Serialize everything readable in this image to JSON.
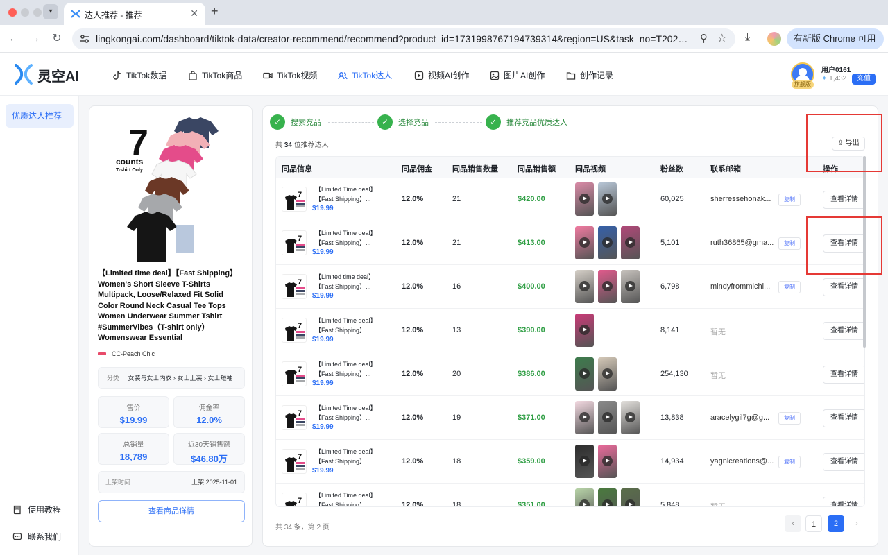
{
  "browser": {
    "tab_title": "达人推荐 - 推荐",
    "tab_close": "✕",
    "new_tab": "+",
    "url": "lingkongai.com/dashboard/tiktok-data/creator-recommend/recommend?product_id=1731998767194739314&region=US&task_no=T20260630193...",
    "update_label": "有新版 Chrome 可用"
  },
  "app": {
    "logo_text": "灵空AI",
    "nav": [
      {
        "label": "TikTok数据",
        "icon": "tiktok-icon"
      },
      {
        "label": "TikTok商品",
        "icon": "shopping-bag-icon"
      },
      {
        "label": "TikTok视频",
        "icon": "video-camera-icon"
      },
      {
        "label": "TikTok达人",
        "icon": "users-icon",
        "active": true
      },
      {
        "label": "视频AI创作",
        "icon": "ai-video-icon"
      },
      {
        "label": "图片AI创作",
        "icon": "image-icon"
      },
      {
        "label": "创作记录",
        "icon": "folder-icon"
      }
    ],
    "user": {
      "name": "用户0161",
      "vip": "旗舰版",
      "points": "1,432",
      "recharge": "充值"
    }
  },
  "sidebar": {
    "active_item": "优质达人推荐",
    "footer": [
      {
        "label": "使用教程",
        "icon": "book-icon"
      },
      {
        "label": "联系我们",
        "icon": "chat-icon"
      }
    ]
  },
  "product": {
    "image_count": "7",
    "image_counts_word": "counts",
    "image_sub": "T-shirt Only",
    "title": "【Limited time deal】【Fast Shipping】Women's Short Sleeve T-Shirts Multipack, Loose/Relaxed Fit Solid Color Round Neck Casual Tee Tops Women Underwear Summer Tshirt #SummerVibes（T-shirt only）Womenswear Essential",
    "shop": "CC-Peach Chic",
    "category_label": "分类",
    "category": "女装与女士内衣 › 女士上装 › 女士短袖",
    "stats": [
      {
        "label": "售价",
        "value": "$19.99"
      },
      {
        "label": "佣金率",
        "value": "12.0%"
      },
      {
        "label": "总销量",
        "value": "18,789"
      },
      {
        "label": "近30天销售额",
        "value": "$46.80万"
      }
    ],
    "listing_label": "上架时间",
    "listing_value": "上架 2025-11-01",
    "view_button": "查看商品详情"
  },
  "steps": [
    "搜索竞品",
    "选择竞品",
    "推荐竞品优质达人"
  ],
  "summary": {
    "prefix": "共",
    "count": "34",
    "suffix": "位推荐达人"
  },
  "export_label": "导出",
  "table": {
    "headers": [
      "同品信息",
      "同品佣金",
      "同品销售数量",
      "同品销售额",
      "同品视频",
      "粉丝数",
      "联系邮箱",
      "操作"
    ],
    "copy_label": "复制",
    "detail_label": "查看详情",
    "rows": [
      {
        "line1": "【Limited Time deal】",
        "line2": "【Fast Shipping】...",
        "price": "$19.99",
        "commission": "12.0%",
        "qty": "21",
        "amount": "$420.00",
        "videos": 2,
        "fans": "60,025",
        "email": "sherressehonak...",
        "has_email": true
      },
      {
        "line1": "【Limited Time deal】",
        "line2": "【Fast Shipping】...",
        "price": "$19.99",
        "commission": "12.0%",
        "qty": "21",
        "amount": "$413.00",
        "videos": 3,
        "fans": "5,101",
        "email": "ruth36865@gma...",
        "has_email": true
      },
      {
        "line1": "【Limited time deal】",
        "line2": "【Fast Shipping】...",
        "price": "$19.99",
        "commission": "12.0%",
        "qty": "16",
        "amount": "$400.00",
        "videos": 3,
        "fans": "6,798",
        "email": "mindyfrommichi...",
        "has_email": true
      },
      {
        "line1": "【Limited Time deal】",
        "line2": "【Fast Shipping】...",
        "price": "$19.99",
        "commission": "12.0%",
        "qty": "13",
        "amount": "$390.00",
        "videos": 1,
        "fans": "8,141",
        "email": "暂无",
        "has_email": false
      },
      {
        "line1": "【Limited Time deal】",
        "line2": "【Fast Shipping】...",
        "price": "$19.99",
        "commission": "12.0%",
        "qty": "20",
        "amount": "$386.00",
        "videos": 2,
        "fans": "254,130",
        "email": "暂无",
        "has_email": false
      },
      {
        "line1": "【Limited Time deal】",
        "line2": "【Fast Shipping】...",
        "price": "$19.99",
        "commission": "12.0%",
        "qty": "19",
        "amount": "$371.00",
        "videos": 3,
        "fans": "13,838",
        "email": "aracelygil7g@g...",
        "has_email": true
      },
      {
        "line1": "【Limited Time deal】",
        "line2": "【Fast Shipping】...",
        "price": "$19.99",
        "commission": "12.0%",
        "qty": "18",
        "amount": "$359.00",
        "videos": 2,
        "fans": "14,934",
        "email": "yagnicreations@...",
        "has_email": true
      },
      {
        "line1": "【Limited Time deal】",
        "line2": "【Fast Shipping】...",
        "price": "$19.99",
        "commission": "12.0%",
        "qty": "18",
        "amount": "$351.00",
        "videos": 3,
        "fans": "5,848",
        "email": "暂无",
        "has_email": false
      }
    ]
  },
  "pagination": {
    "info": "共 34 条，第 2 页",
    "prev": "‹",
    "next": "›",
    "pages": [
      "1",
      "2"
    ],
    "current": "2"
  },
  "colors": {
    "brand": "#2b6ef5",
    "success": "#37b24d",
    "amount": "#2f9e44",
    "highlight_box": "#e53935"
  }
}
